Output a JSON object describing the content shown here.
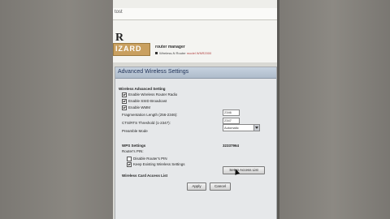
{
  "browser": {
    "address": "tost"
  },
  "header": {
    "logo_letter": "R",
    "logo_text": "IZARD",
    "product_title": "router manager",
    "product_sub": "Wireless-N Router",
    "product_model": "model WNR2000"
  },
  "panel": {
    "title": "Advanced Wireless Settings",
    "section_wireless": "Wireless Advanced Setting",
    "opt_enable_router_radio": "Enable Wireless Router Radio",
    "opt_enable_ssid": "Enable SSID Broadcast",
    "opt_enable_wmm": "Enable WMM",
    "frag_label": "Fragmentation Length (256-2346):",
    "frag_value": "2346",
    "rts_label": "CTS/RTS Threshold (1-2347):",
    "rts_value": "2347",
    "preamble_label": "Preamble Mode",
    "preamble_value": "Automatic",
    "section_wps": "WPS Settings",
    "router_pin_label": "Router's PIN:",
    "router_pin_value": "32337964",
    "opt_disable_pin": "Disable Router's PIN",
    "opt_keep_existing": "Keep Existing Wireless Settings",
    "access_list_label": "Wireless Card Access List",
    "setup_access_list": "Setup Access List",
    "apply": "Apply",
    "cancel": "Cancel"
  },
  "colors": {
    "panel_title_bg": "#aebccb",
    "logo_bg": "#c9a060"
  }
}
